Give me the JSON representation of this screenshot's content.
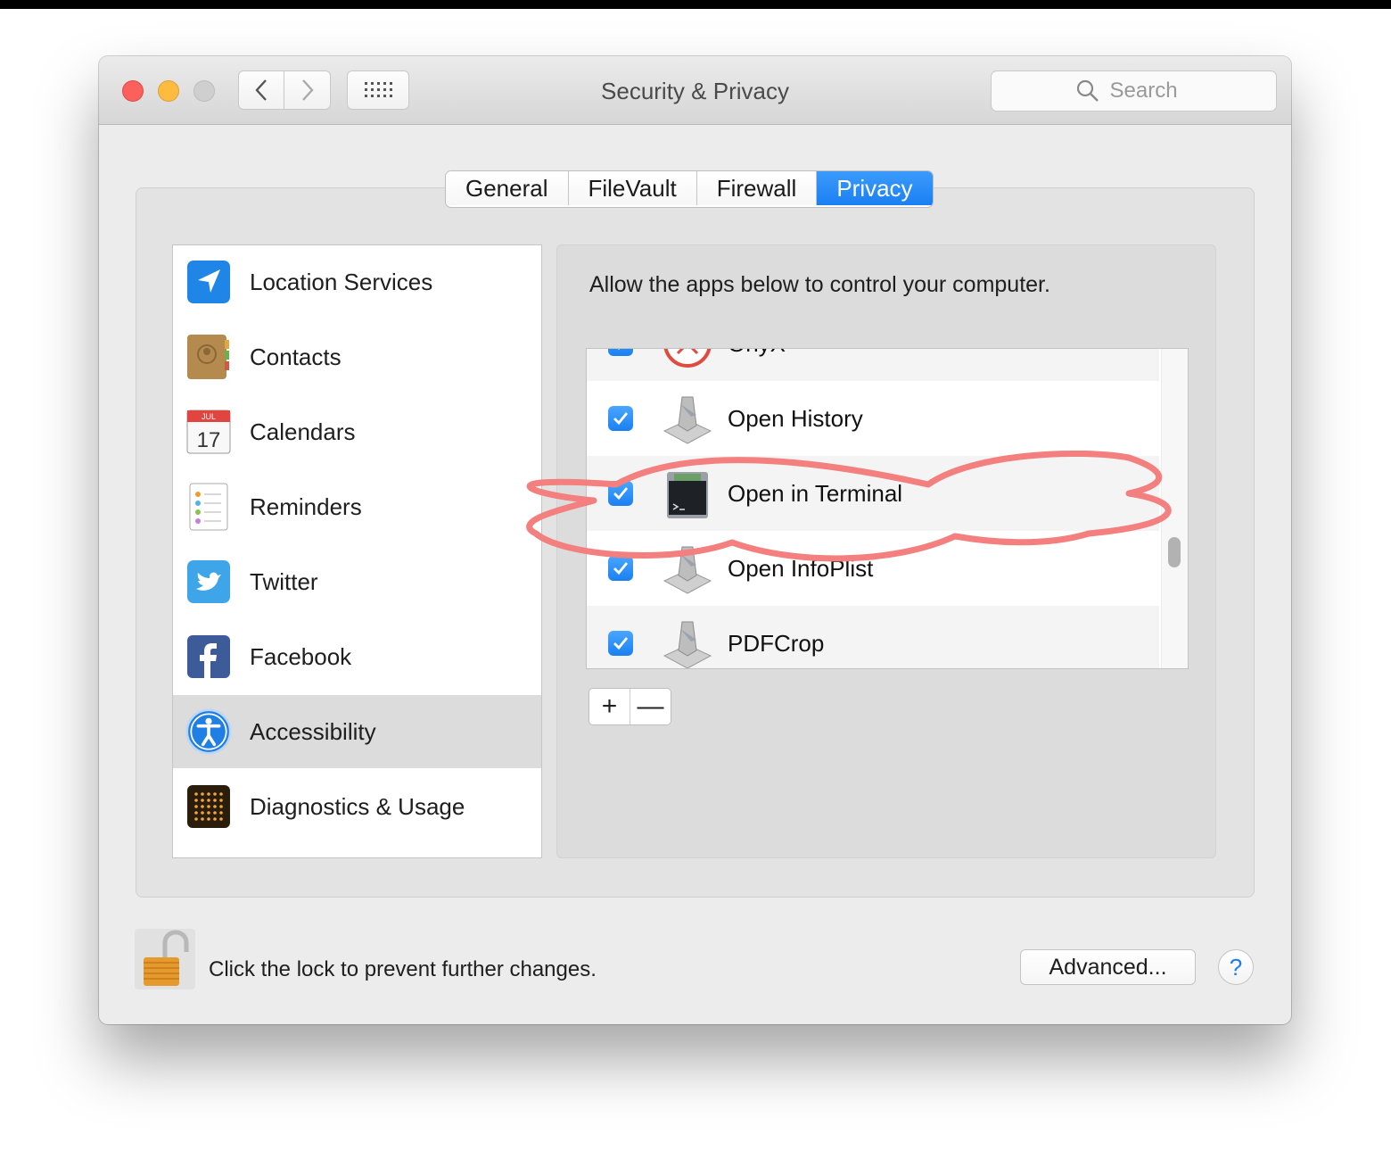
{
  "window": {
    "title": "Security & Privacy"
  },
  "search": {
    "placeholder": "Search"
  },
  "tabs": [
    {
      "label": "General"
    },
    {
      "label": "FileVault"
    },
    {
      "label": "Firewall"
    },
    {
      "label": "Privacy",
      "active": true
    }
  ],
  "sidebar": {
    "items": [
      {
        "label": "Location Services",
        "icon": "location-arrow-icon"
      },
      {
        "label": "Contacts",
        "icon": "contacts-icon"
      },
      {
        "label": "Calendars",
        "icon": "calendar-icon",
        "icon_month": "JUL",
        "icon_day": "17"
      },
      {
        "label": "Reminders",
        "icon": "reminders-icon"
      },
      {
        "label": "Twitter",
        "icon": "twitter-icon"
      },
      {
        "label": "Facebook",
        "icon": "facebook-icon"
      },
      {
        "label": "Accessibility",
        "icon": "accessibility-icon",
        "selected": true
      },
      {
        "label": "Diagnostics & Usage",
        "icon": "diagnostics-icon"
      }
    ]
  },
  "main": {
    "description": "Allow the apps below to control your computer.",
    "apps": [
      {
        "label": "OnyX",
        "checked": true,
        "icon": "onyx-icon"
      },
      {
        "label": "Open History",
        "checked": true,
        "icon": "automator-icon"
      },
      {
        "label": "Open in Terminal",
        "checked": true,
        "icon": "terminal-icon"
      },
      {
        "label": "Open InfoPlist",
        "checked": true,
        "icon": "automator-icon"
      },
      {
        "label": "PDFCrop",
        "checked": true,
        "icon": "automator-icon"
      }
    ],
    "add_label": "+",
    "remove_label": "—"
  },
  "footer": {
    "lock_text": "Click the lock to prevent further changes.",
    "advanced_label": "Advanced...",
    "help_label": "?"
  },
  "colors": {
    "accent": "#1a7ff3",
    "highlight": "#f37f7f"
  }
}
